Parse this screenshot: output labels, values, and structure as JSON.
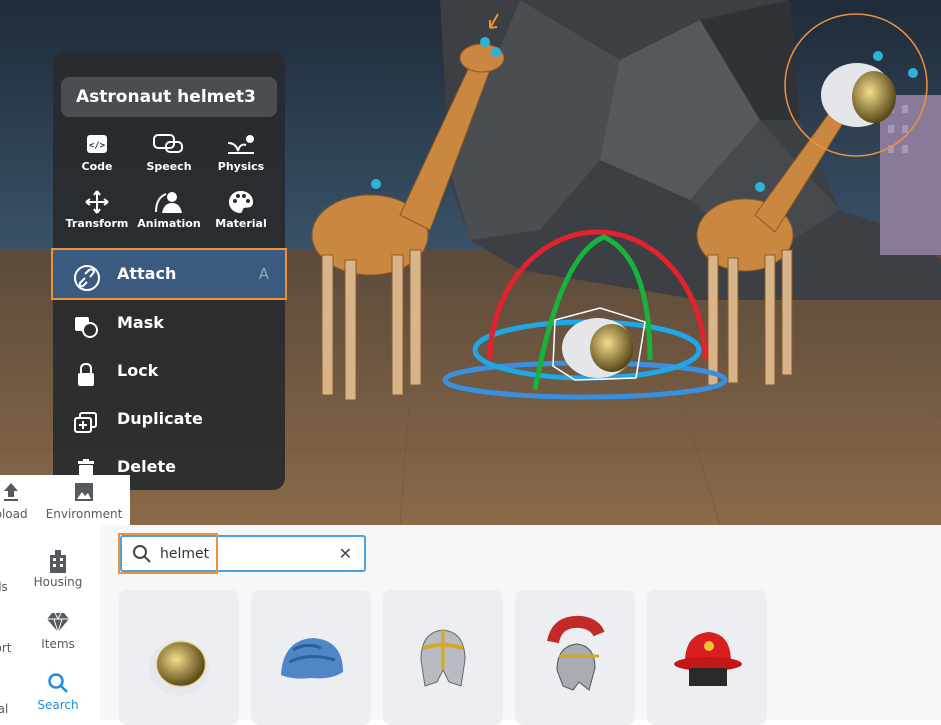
{
  "context_menu": {
    "title": "Astronaut helmet3",
    "tools": [
      {
        "label": "Code",
        "icon": "code-icon"
      },
      {
        "label": "Speech",
        "icon": "speech-icon"
      },
      {
        "label": "Physics",
        "icon": "physics-icon"
      },
      {
        "label": "Transform",
        "icon": "transform-icon"
      },
      {
        "label": "Animation",
        "icon": "animation-icon"
      },
      {
        "label": "Material",
        "icon": "palette-icon"
      }
    ],
    "items": [
      {
        "label": "Attach",
        "shortcut": "A",
        "icon": "link-icon"
      },
      {
        "label": "Mask",
        "icon": "mask-icon"
      },
      {
        "label": "Lock",
        "icon": "lock-icon"
      },
      {
        "label": "Duplicate",
        "icon": "duplicate-icon"
      },
      {
        "label": "Delete",
        "icon": "trash-icon"
      }
    ]
  },
  "library": {
    "top_tabs": [
      {
        "label": "pload",
        "icon": "upload-icon"
      },
      {
        "label": "Environment",
        "icon": "environment-icon"
      }
    ],
    "sidebar": [
      {
        "label": "ls",
        "icon": ""
      },
      {
        "label": "Housing",
        "icon": "building-icon"
      },
      {
        "label": "ort",
        "icon": ""
      },
      {
        "label": "Items",
        "icon": "diamond-icon"
      },
      {
        "label": "al",
        "icon": ""
      },
      {
        "label": "Search",
        "icon": "search-icon"
      }
    ],
    "search": {
      "value": "helmet"
    },
    "results": [
      {
        "name": "astronaut-helmet"
      },
      {
        "name": "bicycle-helmet"
      },
      {
        "name": "knight-helmet"
      },
      {
        "name": "roman-helmet"
      },
      {
        "name": "firefighter-helmet"
      }
    ]
  },
  "colors": {
    "accent": "#f0913a",
    "selection": "#3a5a80",
    "search_active": "#1e8fdc"
  }
}
